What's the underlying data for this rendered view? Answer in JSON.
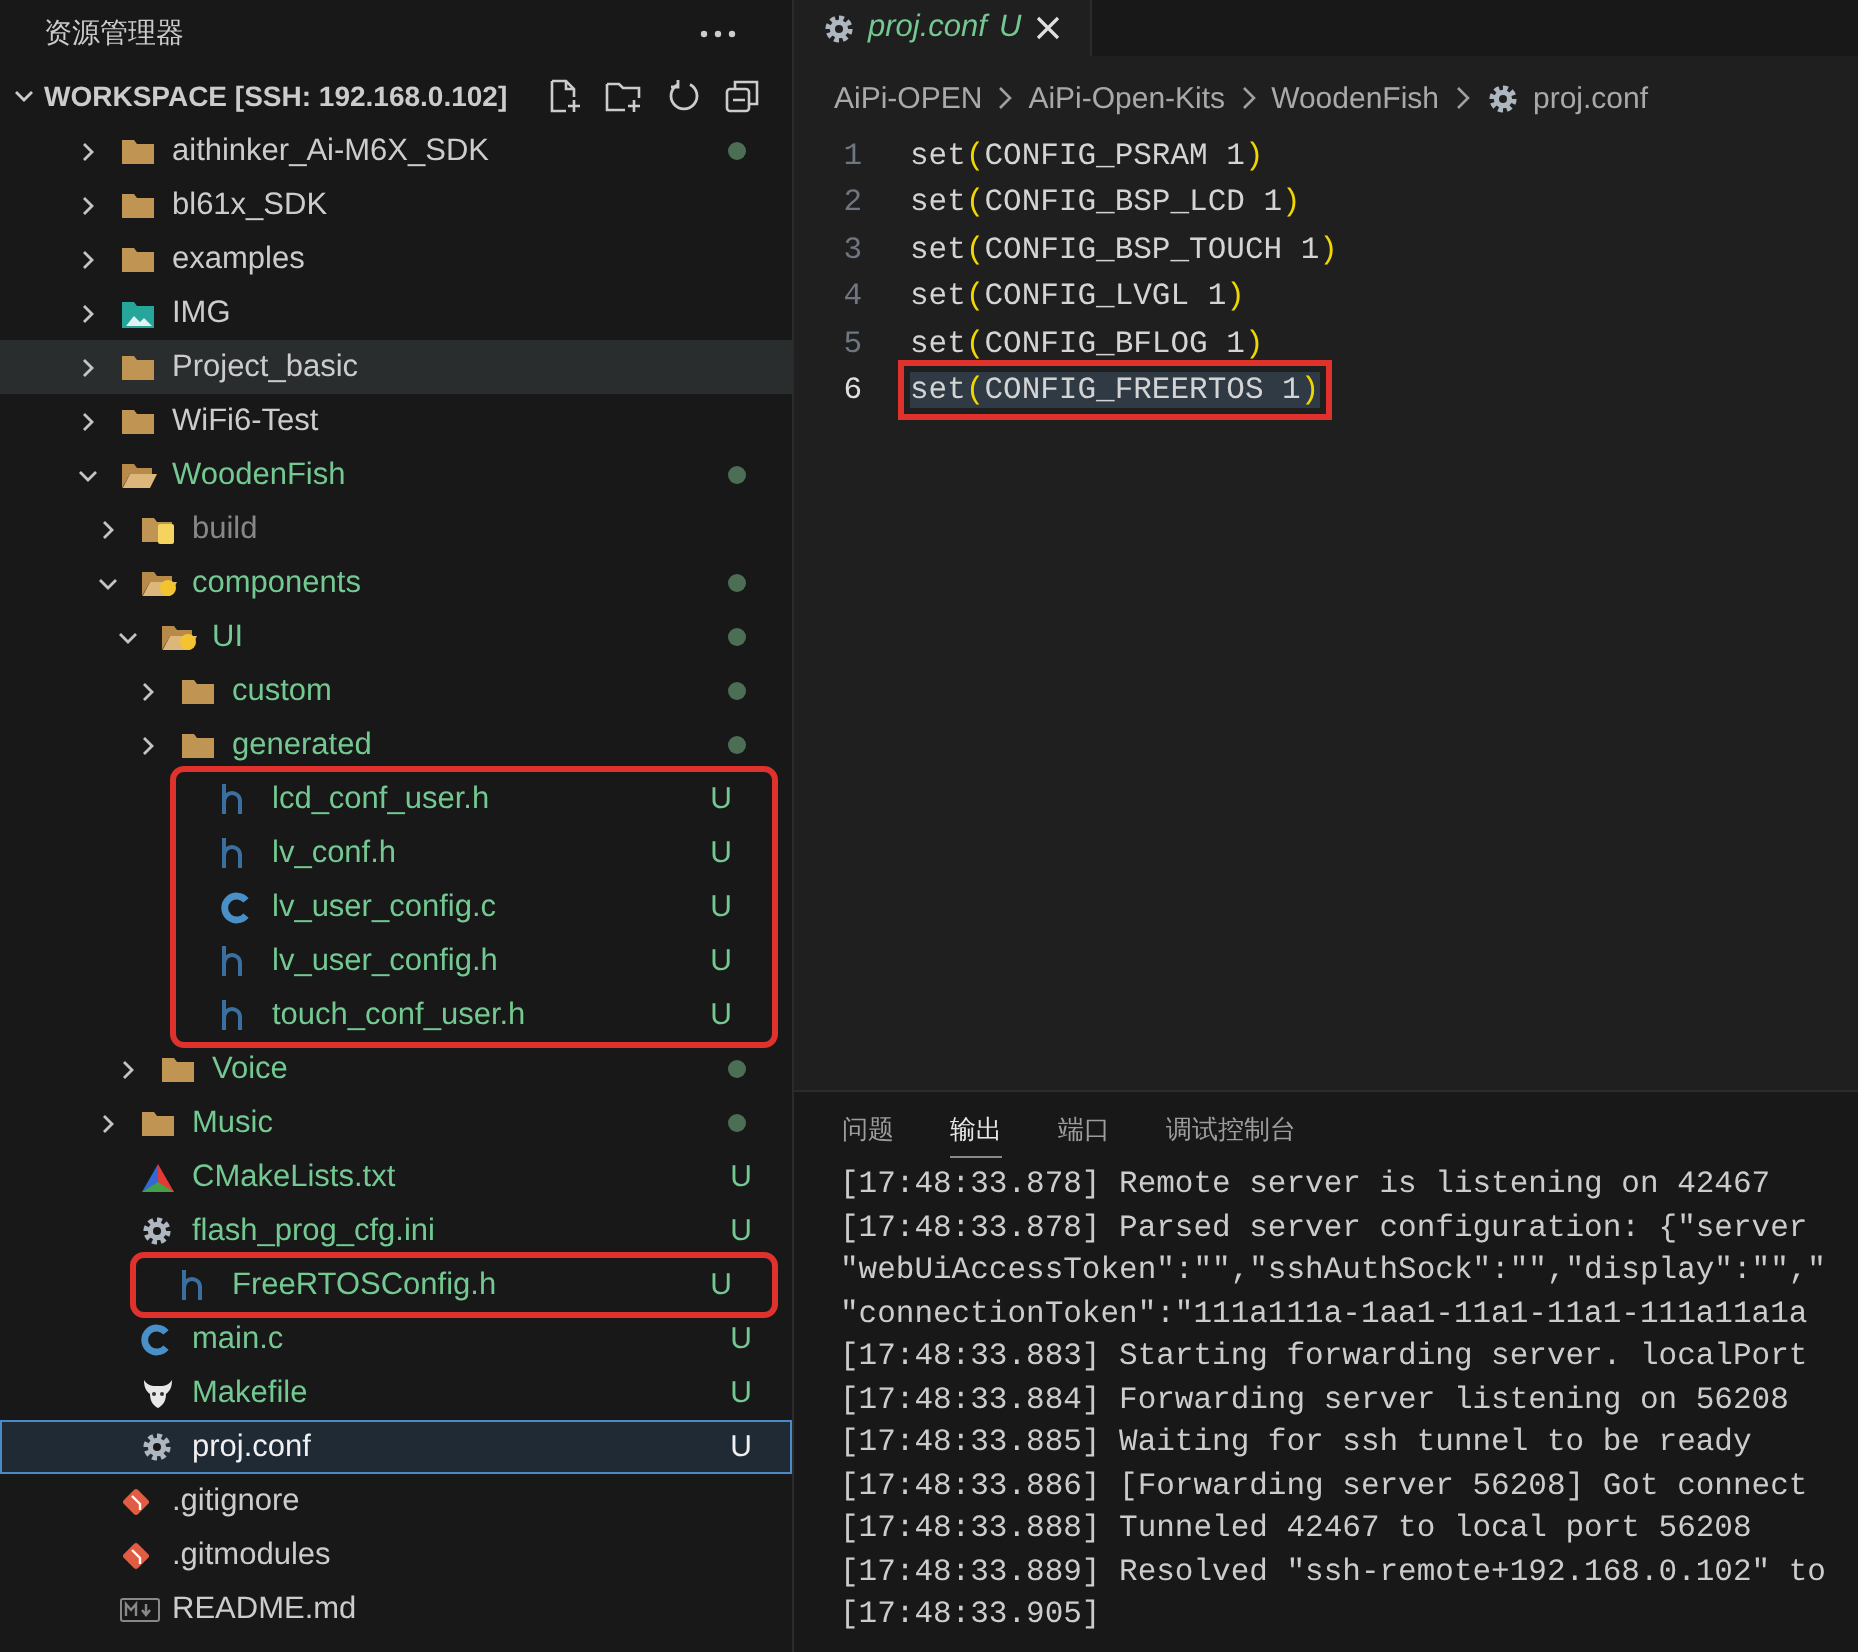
{
  "explorer": {
    "title": "资源管理器",
    "workspace": {
      "label": "WORKSPACE [SSH: 192.168.0.102]",
      "expanded": true
    },
    "tree": [
      {
        "name": "aithinker_Ai-M6X_SDK",
        "kind": "folder",
        "untracked": false,
        "ignored": false,
        "expanded": false,
        "dot": true,
        "selected": false,
        "hovered": false,
        "highlighted": false
      },
      {
        "name": "bl61x_SDK",
        "kind": "folder",
        "untracked": false,
        "ignored": false,
        "expanded": false,
        "selected": false,
        "hovered": false,
        "highlighted": false
      },
      {
        "name": "examples",
        "kind": "folder",
        "untracked": false,
        "ignored": false,
        "expanded": false,
        "selected": false,
        "hovered": false,
        "highlighted": false
      },
      {
        "name": "IMG",
        "kind": "images",
        "untracked": false,
        "ignored": false,
        "expanded": false,
        "selected": false,
        "hovered": false,
        "highlighted": false
      },
      {
        "name": "Project_basic",
        "kind": "folder",
        "untracked": false,
        "ignored": false,
        "expanded": false,
        "selected": false,
        "hovered": true,
        "highlighted": false
      },
      {
        "name": "WiFi6-Test",
        "kind": "folder",
        "untracked": false,
        "ignored": false,
        "expanded": false,
        "selected": false,
        "hovered": false,
        "highlighted": false
      },
      {
        "name": "WoodenFish",
        "kind": "folder",
        "untracked": true,
        "ignored": false,
        "expanded": true,
        "dot": true,
        "selected": false,
        "hovered": false,
        "highlighted": false,
        "children": [
          {
            "name": "build",
            "kind": "special",
            "untracked": false,
            "ignored": true,
            "expanded": false,
            "selected": false,
            "hovered": false,
            "highlighted": false
          },
          {
            "name": "components",
            "kind": "special",
            "untracked": true,
            "ignored": false,
            "expanded": true,
            "dot": true,
            "selected": false,
            "hovered": false,
            "highlighted": false,
            "children": [
              {
                "name": "UI",
                "kind": "special",
                "untracked": true,
                "ignored": false,
                "expanded": true,
                "dot": true,
                "selected": false,
                "hovered": false,
                "highlighted": false,
                "children": [
                  {
                    "name": "custom",
                    "kind": "folder",
                    "untracked": true,
                    "ignored": false,
                    "expanded": false,
                    "dot": true,
                    "selected": false,
                    "hovered": false,
                    "highlighted": false
                  },
                  {
                    "name": "generated",
                    "kind": "folder",
                    "untracked": true,
                    "ignored": false,
                    "expanded": false,
                    "dot": true,
                    "selected": false,
                    "hovered": false,
                    "highlighted": false
                  },
                  {
                    "name": "lcd_conf_user.h",
                    "kind": "header",
                    "untracked": true,
                    "ignored": false,
                    "badge": "U",
                    "selected": false,
                    "hovered": false,
                    "highlighted": true
                  },
                  {
                    "name": "lv_conf.h",
                    "kind": "header",
                    "untracked": true,
                    "ignored": false,
                    "badge": "U",
                    "selected": false,
                    "hovered": false,
                    "highlighted": true
                  },
                  {
                    "name": "lv_user_config.c",
                    "kind": "source",
                    "untracked": true,
                    "ignored": false,
                    "badge": "U",
                    "selected": false,
                    "hovered": false,
                    "highlighted": true
                  },
                  {
                    "name": "lv_user_config.h",
                    "kind": "header",
                    "untracked": true,
                    "ignored": false,
                    "badge": "U",
                    "selected": false,
                    "hovered": false,
                    "highlighted": true
                  },
                  {
                    "name": "touch_conf_user.h",
                    "kind": "header",
                    "untracked": true,
                    "ignored": false,
                    "badge": "U",
                    "selected": false,
                    "hovered": false,
                    "highlighted": true
                  }
                ]
              },
              {
                "name": "Voice",
                "kind": "folder",
                "untracked": true,
                "ignored": false,
                "expanded": false,
                "dot": true,
                "selected": false,
                "hovered": false,
                "highlighted": false
              }
            ]
          },
          {
            "name": "Music",
            "kind": "folder",
            "untracked": true,
            "ignored": false,
            "expanded": false,
            "dot": true,
            "selected": false,
            "hovered": false,
            "highlighted": false
          },
          {
            "name": "CMakeLists.txt",
            "kind": "cmake",
            "untracked": true,
            "ignored": false,
            "badge": "U",
            "selected": false,
            "hovered": false,
            "highlighted": false
          },
          {
            "name": "flash_prog_cfg.ini",
            "kind": "config",
            "untracked": true,
            "ignored": false,
            "badge": "U",
            "selected": false,
            "hovered": false,
            "highlighted": false
          },
          {
            "name": "FreeRTOSConfig.h",
            "kind": "header",
            "untracked": true,
            "ignored": false,
            "badge": "U",
            "selected": false,
            "hovered": false,
            "highlighted": true
          },
          {
            "name": "main.c",
            "kind": "source",
            "untracked": true,
            "ignored": false,
            "badge": "U",
            "selected": false,
            "hovered": false,
            "highlighted": false
          },
          {
            "name": "Makefile",
            "kind": "makefile",
            "untracked": true,
            "ignored": false,
            "badge": "U",
            "selected": false,
            "hovered": false,
            "highlighted": false
          },
          {
            "name": "proj.conf",
            "kind": "config",
            "untracked": true,
            "ignored": false,
            "badge": "U",
            "selected": true,
            "hovered": false,
            "highlighted": false
          }
        ]
      },
      {
        "name": ".gitignore",
        "kind": "git",
        "untracked": false,
        "ignored": false,
        "selected": false,
        "hovered": false,
        "highlighted": false
      },
      {
        "name": ".gitmodules",
        "kind": "git",
        "untracked": false,
        "ignored": false,
        "selected": false,
        "hovered": false,
        "highlighted": false
      },
      {
        "name": "README.md",
        "kind": "markdown",
        "untracked": false,
        "ignored": false,
        "selected": false,
        "hovered": false,
        "highlighted": false
      }
    ]
  },
  "editor": {
    "tab": {
      "name": "proj.conf",
      "badge": "U"
    },
    "breadcrumbs": [
      {
        "label": "AiPi-OPEN",
        "kind": "folder"
      },
      {
        "label": "AiPi-Open-Kits",
        "kind": "folder"
      },
      {
        "label": "WoodenFish",
        "kind": "folder"
      },
      {
        "label": "proj.conf",
        "kind": "config"
      }
    ],
    "lines": [
      {
        "number": "1",
        "text": "set(CONFIG_PSRAM 1)",
        "current": false,
        "highlighted": false
      },
      {
        "number": "2",
        "text": "set(CONFIG_BSP_LCD 1)",
        "current": false,
        "highlighted": false
      },
      {
        "number": "3",
        "text": "set(CONFIG_BSP_TOUCH 1)",
        "current": false,
        "highlighted": false
      },
      {
        "number": "4",
        "text": "set(CONFIG_LVGL 1)",
        "current": false,
        "highlighted": false
      },
      {
        "number": "5",
        "text": "set(CONFIG_BFLOG 1)",
        "current": false,
        "highlighted": false
      },
      {
        "number": "6",
        "text": "set(CONFIG_FREERTOS 1)",
        "current": true,
        "highlighted": true
      }
    ]
  },
  "panel": {
    "tabs": [
      {
        "label": "问题",
        "selected": false
      },
      {
        "label": "输出",
        "selected": true
      },
      {
        "label": "端口",
        "selected": false
      },
      {
        "label": "调试控制台",
        "selected": false
      }
    ],
    "output": [
      "[17:48:33.878] Remote server is listening on 42467",
      "[17:48:33.878] Parsed server configuration: {\"server",
      "\"webUiAccessToken\":\"\",\"sshAuthSock\":\"\",\"display\":\"\",\"",
      "\"connectionToken\":\"111a111a-1aa1-11a1-11a1-111a11a1a",
      "[17:48:33.883] Starting forwarding server. localPort",
      "[17:48:33.884] Forwarding server listening on 56208",
      "[17:48:33.885] Waiting for ssh tunnel to be ready",
      "[17:48:33.886] [Forwarding server 56208] Got connect",
      "[17:48:33.888] Tunneled 42467 to local port 56208",
      "[17:48:33.889] Resolved \"ssh-remote+192.168.0.102\" to",
      "[17:48:33.905]"
    ]
  }
}
